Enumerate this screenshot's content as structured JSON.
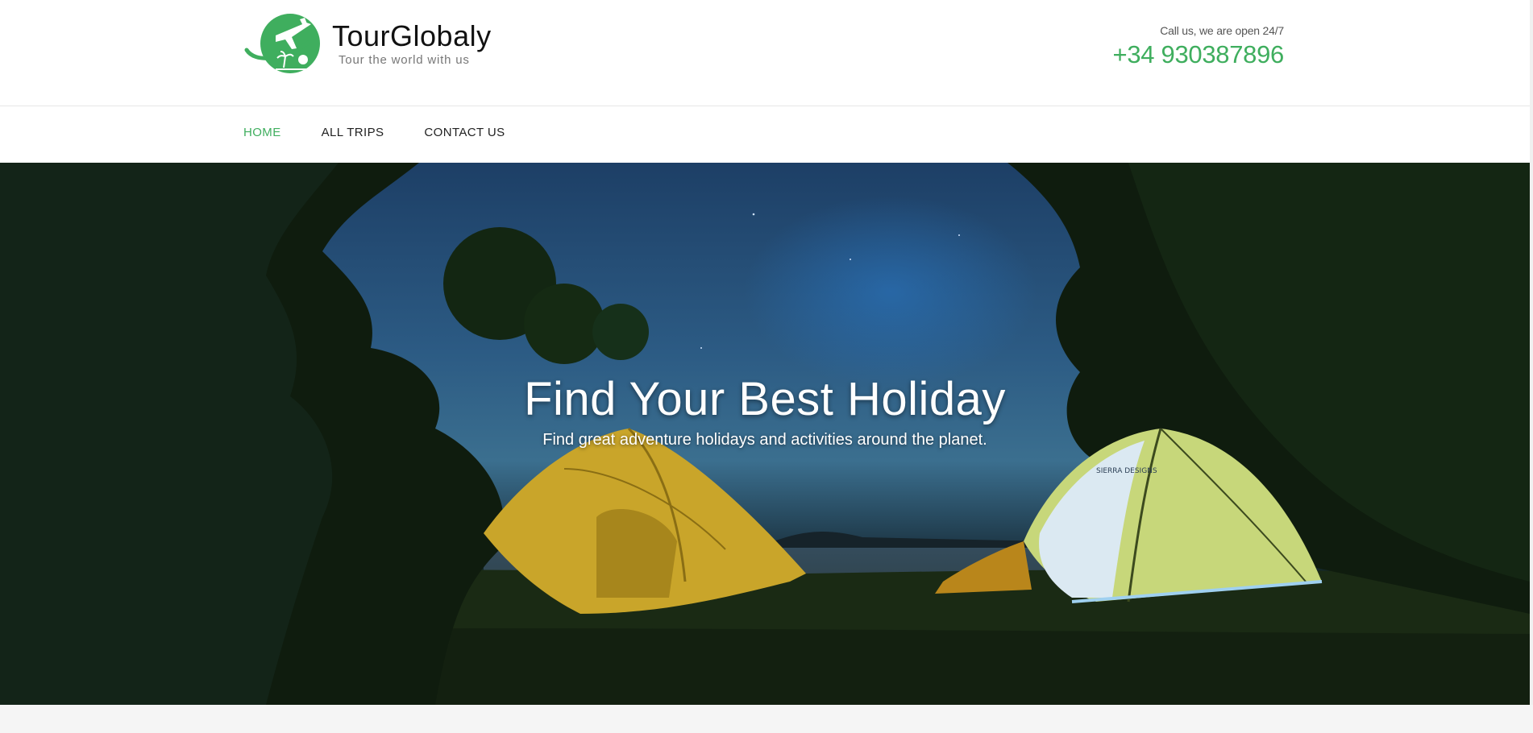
{
  "brand": {
    "name": "TourGlobaly",
    "tagline": "Tour the world with us",
    "accent_color": "#3fae5e"
  },
  "contact": {
    "note": "Call us, we are open 24/7",
    "phone": "+34 930387896"
  },
  "nav": {
    "items": [
      {
        "label": "HOME",
        "active": true
      },
      {
        "label": "ALL TRIPS",
        "active": false
      },
      {
        "label": "CONTACT US",
        "active": false
      }
    ]
  },
  "hero": {
    "title": "Find Your Best Holiday",
    "subtitle": "Find great adventure holidays and activities around the planet.",
    "tent_brand": "SIERRA DESIGNS"
  }
}
